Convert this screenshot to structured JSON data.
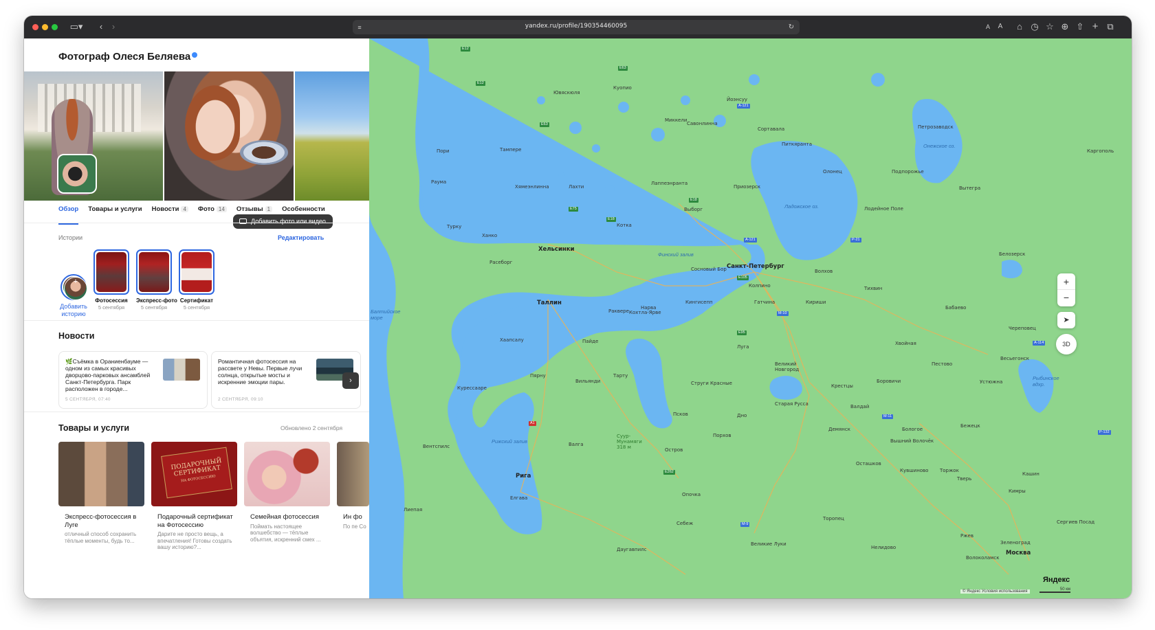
{
  "browser": {
    "url": "yandex.ru/profile/190354460095"
  },
  "profile": {
    "title": "Фотограф Олеся Беляева",
    "add_photo": "Добавить фото или видео",
    "tabs": [
      {
        "label": "Обзор",
        "count": ""
      },
      {
        "label": "Товары и услуги",
        "count": ""
      },
      {
        "label": "Новости",
        "count": "4"
      },
      {
        "label": "Фото",
        "count": "14"
      },
      {
        "label": "Отзывы",
        "count": "1"
      },
      {
        "label": "Особенности",
        "count": ""
      }
    ],
    "stories": {
      "label": "Истории",
      "edit": "Редактировать",
      "add_line1": "Добавить",
      "add_line2": "историю",
      "items": [
        {
          "name": "Фотосессия",
          "date": "5 сентября"
        },
        {
          "name": "Экспресс-фото",
          "date": "5 сентября"
        },
        {
          "name": "Сертификат",
          "date": "5 сентября"
        }
      ]
    },
    "news": {
      "title": "Новости",
      "items": [
        {
          "text": "🌿Съёмка в Ораниенбауме — одном из самых красивых дворцово-парковых ансамблей Санкт-Петербурга. Парк расположен в городе...",
          "date": "5 СЕНТЯБРЯ, 07:40"
        },
        {
          "text": "Романтичная фотосессия на рассвете у Невы. Первые лучи солнца, открытые мосты и искренние эмоции пары.",
          "date": "2 СЕНТЯБРЯ, 09:10"
        }
      ],
      "next": "›"
    },
    "products": {
      "title": "Товары и услуги",
      "updated": "Обновлено 2 сентября",
      "items": [
        {
          "title": "Экспресс-фотосессия в Луге",
          "desc": "отличный способ сохранить тёплые моменты, будь то..."
        },
        {
          "title": "Подарочный сертификат на Фотосессию",
          "desc": "Дарите не просто вещь, а впечатления! Готовы создать вашу историю?..."
        },
        {
          "title": "Семейная фотосессия",
          "desc": "Поймать настоящее волшебство — тёплые объятия, искренний смех ..."
        },
        {
          "title": "Ин фо",
          "desc": "По пе Со"
        }
      ],
      "certificate_line1": "ПОДАРОЧНЫЙ",
      "certificate_line2": "СЕРТИФИКАТ",
      "certificate_line3": "НА ФОТОСЕССИЮ"
    }
  },
  "map": {
    "zoom_in": "+",
    "zoom_out": "−",
    "locate": "➤",
    "mode_3d": "3D",
    "brand": "Яндекс",
    "copyright": "© Яндекс   Условия использования",
    "scale": "50 км",
    "water": {
      "ladoga": "Ладожское оз.",
      "onega": "Онежское оз.",
      "baltic": "Балтийское море",
      "finland_gulf": "Финский залив",
      "riga_gulf": "Рижский залив",
      "rybinsk": "Рыбинское вдхр."
    },
    "cities": {
      "spb": "Санкт-Петербург",
      "helsinki": "Хельсинки",
      "tallinn": "Таллин",
      "riga": "Рига",
      "tampere": "Тампере",
      "turku": "Турку",
      "petrozavodsk": "Петрозаводск",
      "vyborg": "Выборг",
      "tver": "Тверь",
      "moscow": "Москва",
      "novgorod": "Великий Новгород",
      "pskov": "Псков",
      "tartu": "Тарту",
      "pyarnu": "Пярну",
      "kolpino": "Колпино",
      "kirishi": "Кириши",
      "tikhvin": "Тихвин",
      "staraya_russa": "Старая Русса",
      "cherepovets": "Череповец",
      "vologda_dir": "Весьегонск",
      "kuopio": "Куопио",
      "joensuu": "Йоэнсуу",
      "lappeenranta": "Лаппеэнранта",
      "kotka": "Котка",
      "sortavala": "Сортавала",
      "lahti": "Лахти",
      "kingisepp": "Кингисепп",
      "narva": "Нарва",
      "ostrov": "Остров",
      "valga": "Валга",
      "velikiye_luki": "Великие Луки",
      "rzhev": "Ржев",
      "bologoye": "Бологое",
      "vyshny_volochek": "Вышний Волочёк",
      "borovichi": "Боровичи",
      "torzhok": "Торжок",
      "ventspils": "Вентспилс",
      "liepaja": "Лиепая",
      "daugavpils": "Даугавпилс",
      "jelgava": "Елгава",
      "kuressaare": "Курессааре",
      "haapsalu": "Хаапсалу",
      "paide": "Пайде",
      "viljandi": "Вильянди",
      "rakvere": "Раквере",
      "gatchina": "Гатчина",
      "luga": "Луга",
      "porkhov": "Порхов",
      "dno": "Дно",
      "olonets": "Олонец",
      "lodeynoye_pole": "Лодейное Поле",
      "podporozhye": "Подпорожье",
      "vytegra": "Вытегра",
      "belozersk": "Белозерск",
      "kargopol": "Каргополь",
      "mikkeli": "Миккели",
      "savonlinna": "Савонлинна",
      "pori": "Пори",
      "rauma": "Раума",
      "hameenlinna": "Хямеэнлинна",
      "jyvaskyla": "Ювяскюля",
      "raseborg": "Расеборг",
      "hanko": "Ханко",
      "kotla_yarve": "Кохтла-Ярве",
      "sosnovy_bor": "Сосновый Бор",
      "priozersk": "Приозерск",
      "pitkyaranta": "Питкяранта",
      "volkhov": "Волхов",
      "strugi": "Струги Красные",
      "krestsy": "Крестцы",
      "demyansk": "Демянск",
      "ostashkov": "Осташков",
      "toropets": "Торопец",
      "nelidovo": "Нелидово",
      "sebezh": "Себеж",
      "opochka": "Опочка",
      "zelenograd": "Зеленоград",
      "sergiev_posad": "Сергиев Посад",
      "kimry": "Кимры",
      "kashin": "Кашин",
      "bezhetsk": "Бежецк",
      "pestovo": "Пестово",
      "ustyuzhna": "Устюжна",
      "babaevo": "Бабаево",
      "kholmogory": "Хвойная",
      "valday": "Валдай",
      "kuvshinovo": "Кувшиново",
      "volokolamsk": "Волоколамск",
      "sura_munamagi": "Суур-Мунамяги 318 м"
    }
  },
  "colors": {
    "accent": "#2e67e0",
    "map_land": "#8fd58c",
    "map_water": "#6bb6f2"
  }
}
